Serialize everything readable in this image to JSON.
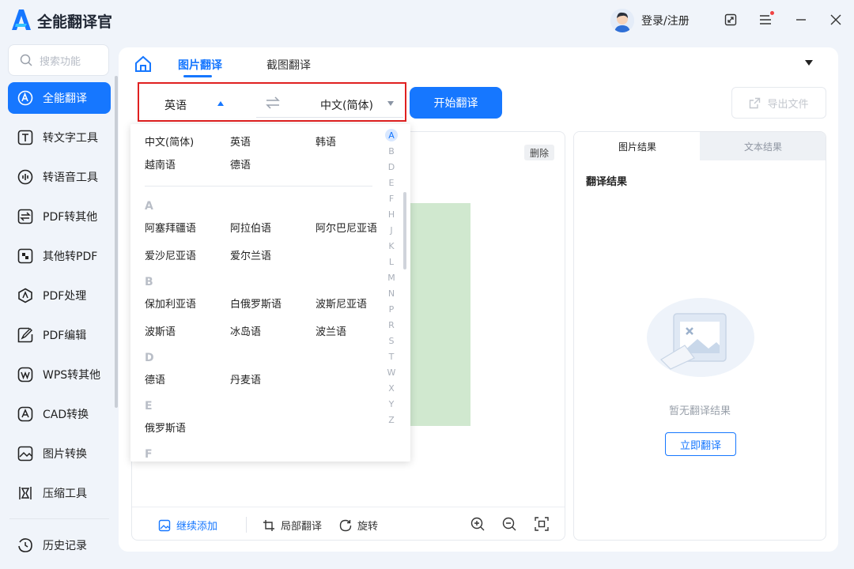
{
  "app": {
    "title": "全能翻译官",
    "login_label": "登录/注册"
  },
  "sidebar": {
    "search_placeholder": "搜索功能",
    "items": [
      {
        "label": "全能翻译"
      },
      {
        "label": "转文字工具"
      },
      {
        "label": "转语音工具"
      },
      {
        "label": "PDF转其他"
      },
      {
        "label": "其他转PDF"
      },
      {
        "label": "PDF处理"
      },
      {
        "label": "PDF编辑"
      },
      {
        "label": "WPS转其他"
      },
      {
        "label": "CAD转换"
      },
      {
        "label": "图片转换"
      },
      {
        "label": "压缩工具"
      }
    ],
    "history_label": "历史记录"
  },
  "main": {
    "tabs": [
      {
        "label": "图片翻译"
      },
      {
        "label": "截图翻译"
      }
    ],
    "source_lang": "英语",
    "target_lang": "中文(简体)",
    "start_button": "开始翻译",
    "export_button": "导出文件",
    "delete_label": "删除",
    "bottom": {
      "add_more": "继续添加",
      "partial": "局部翻译",
      "rotate": "旋转"
    }
  },
  "result": {
    "tabs": [
      {
        "label": "图片结果"
      },
      {
        "label": "文本结果"
      }
    ],
    "title": "翻译结果",
    "empty_text": "暂无翻译结果",
    "translate_now": "立即翻译"
  },
  "dropdown": {
    "common": [
      "中文(简体)",
      "英语",
      "韩语",
      "越南语",
      "德语"
    ],
    "sections": [
      {
        "letter": "A",
        "langs": [
          "阿塞拜疆语",
          "阿拉伯语",
          "阿尔巴尼亚语",
          "爱沙尼亚语",
          "爱尔兰语"
        ]
      },
      {
        "letter": "B",
        "langs": [
          "保加利亚语",
          "白俄罗斯语",
          "波斯尼亚语",
          "波斯语",
          "冰岛语",
          "波兰语"
        ]
      },
      {
        "letter": "D",
        "langs": [
          "德语",
          "丹麦语"
        ]
      },
      {
        "letter": "E",
        "langs": [
          "俄罗斯语"
        ]
      },
      {
        "letter": "F",
        "langs": []
      }
    ],
    "alphabet": [
      "A",
      "B",
      "D",
      "E",
      "F",
      "H",
      "J",
      "K",
      "L",
      "M",
      "N",
      "P",
      "R",
      "S",
      "T",
      "W",
      "X",
      "Y",
      "Z"
    ],
    "selected_letter": "A"
  },
  "colors": {
    "accent": "#1677ff",
    "highlight_border": "#e02020",
    "preview_fill": "#d0e8cf"
  }
}
